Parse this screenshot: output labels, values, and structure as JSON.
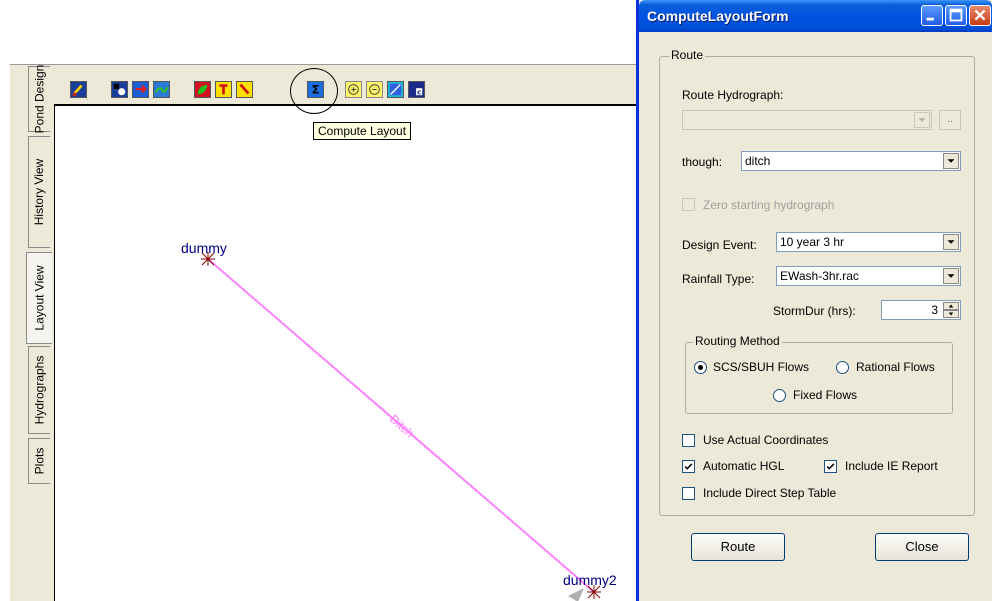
{
  "tabs": [
    {
      "label": "Pond Design"
    },
    {
      "label": "History View"
    },
    {
      "label": "Layout View"
    },
    {
      "label": "Hydrographs"
    },
    {
      "label": "Plots"
    }
  ],
  "tooltip": {
    "text": "Compute Layout"
  },
  "layout": {
    "nodes": [
      {
        "label": "dummy"
      },
      {
        "label": "dummy2"
      }
    ],
    "link": {
      "label": "Ditch",
      "color": "#ff80ff"
    }
  },
  "dialog": {
    "title": "ComputeLayoutForm",
    "route_group_label": "Route",
    "route_hydrograph_label": "Route Hydrograph:",
    "route_hydrograph_value": "",
    "browse_label": "..",
    "through_label": "though:",
    "through_value": "ditch",
    "zero_starting_label": "Zero starting hydrograph",
    "design_event_label": "Design Event:",
    "design_event_value": "10 year 3 hr",
    "rainfall_type_label": "Rainfall Type:",
    "rainfall_type_value": "EWash-3hr.rac",
    "storm_dur_label": "StormDur (hrs):",
    "storm_dur_value": "3",
    "routing_method": {
      "label": "Routing Method",
      "options": [
        "SCS/SBUH Flows",
        "Rational Flows",
        "Fixed Flows"
      ],
      "selected": "SCS/SBUH Flows"
    },
    "use_actual_coords_label": "Use Actual Coordinates",
    "automatic_hgl_label": "Automatic HGL",
    "include_ie_report_label": "Include IE Report",
    "include_direct_step_label": "Include Direct Step Table",
    "route_button": "Route",
    "close_button": "Close"
  },
  "colors": {
    "titlebar": "#0054e3",
    "dialog_bg": "#ece9d8",
    "node_label": "#000080",
    "link": "#ff80ff"
  }
}
